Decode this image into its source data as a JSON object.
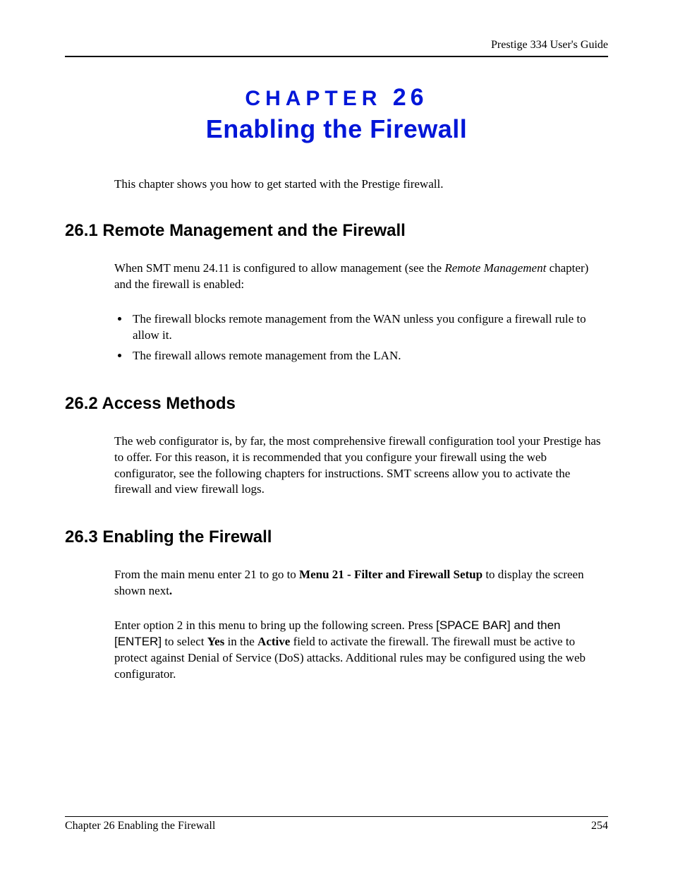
{
  "header": {
    "guide_title": "Prestige 334 User's Guide"
  },
  "chapter": {
    "label": "CHAPTER ",
    "number": "26",
    "title": "Enabling the Firewall",
    "intro": "This chapter shows you how to get started with the Prestige firewall."
  },
  "sections": {
    "s1": {
      "heading": "26.1  Remote Management and the Firewall",
      "para_prefix": "When SMT menu 24.11 is configured to allow management (see the ",
      "para_italic": "Remote Management",
      "para_suffix": " chapter) and the firewall is enabled:",
      "bullets": [
        "The firewall blocks remote management from the WAN unless you configure a firewall rule to allow it.",
        "The firewall allows remote management from the LAN."
      ]
    },
    "s2": {
      "heading": "26.2  Access Methods",
      "para": "The web configurator is, by far, the most comprehensive firewall configuration tool your Prestige has to offer. For this reason, it is recommended that you configure your firewall using the web configurator, see the following chapters for instructions. SMT screens allow you to activate the firewall and view firewall logs."
    },
    "s3": {
      "heading": "26.3  Enabling the Firewall",
      "p1_a": "From the main menu enter 21 to go to ",
      "p1_bold": "Menu 21 - Filter and Firewall Setup",
      "p1_b": " to display the screen shown next",
      "p1_dot": ".",
      "p2_a": "Enter option 2 in this menu to bring up the following screen. Press ",
      "p2_key1": "[SPACE BAR]",
      "p2_b": " and then ",
      "p2_key2": "[ENTER]",
      "p2_c": " to select ",
      "p2_yes": "Yes",
      "p2_d": " in the ",
      "p2_active": "Active",
      "p2_e": " field to activate the firewall. The firewall must be active to protect against Denial of Service (DoS) attacks. Additional rules may be configured using the web configurator."
    }
  },
  "footer": {
    "left": "Chapter 26 Enabling the Firewall",
    "right": "254"
  }
}
